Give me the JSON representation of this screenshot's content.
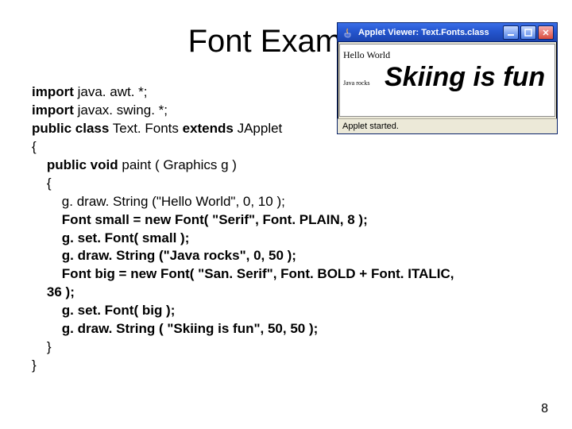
{
  "title": "Font Example",
  "code_lines": [
    {
      "indent": 0,
      "runs": [
        {
          "b": true,
          "t": "import"
        },
        {
          "b": false,
          "t": " java. awt. *;"
        }
      ]
    },
    {
      "indent": 0,
      "runs": [
        {
          "b": true,
          "t": "import"
        },
        {
          "b": false,
          "t": " javax. swing. *;"
        }
      ]
    },
    {
      "indent": 0,
      "runs": [
        {
          "b": true,
          "t": "public class"
        },
        {
          "b": false,
          "t": " Text. Fonts "
        },
        {
          "b": true,
          "t": "extends"
        },
        {
          "b": false,
          "t": " JApplet"
        }
      ]
    },
    {
      "indent": 0,
      "runs": [
        {
          "b": false,
          "t": "{"
        }
      ]
    },
    {
      "indent": 1,
      "runs": [
        {
          "b": true,
          "t": "public void"
        },
        {
          "b": false,
          "t": " paint ( Graphics g )"
        }
      ]
    },
    {
      "indent": 1,
      "runs": [
        {
          "b": false,
          "t": "{"
        }
      ]
    },
    {
      "indent": 2,
      "runs": [
        {
          "b": false,
          "t": "g. draw. String (\"Hello World\", 0, 10 );"
        }
      ]
    },
    {
      "indent": 2,
      "runs": [
        {
          "b": true,
          "t": "Font small = new Font( \"Serif\", Font. PLAIN, 8 );"
        }
      ]
    },
    {
      "indent": 2,
      "runs": [
        {
          "b": true,
          "t": "g. set. Font( small );"
        }
      ]
    },
    {
      "indent": 2,
      "runs": [
        {
          "b": true,
          "t": "g. draw. String (\"Java rocks\", 0, 50 );"
        }
      ]
    },
    {
      "indent": 2,
      "runs": [
        {
          "b": true,
          "t": "Font big = new Font( \"San. Serif\", Font. BOLD + Font. ITALIC,"
        }
      ]
    },
    {
      "indent": 1,
      "runs": [
        {
          "b": true,
          "t": "36 );"
        }
      ]
    },
    {
      "indent": 2,
      "runs": [
        {
          "b": true,
          "t": "g. set. Font( big );"
        }
      ]
    },
    {
      "indent": 2,
      "runs": [
        {
          "b": true,
          "t": "g. draw. String ( \"Skiing is fun\", 50, 50 );"
        }
      ]
    },
    {
      "indent": 1,
      "runs": [
        {
          "b": false,
          "t": "}"
        }
      ]
    },
    {
      "indent": 0,
      "runs": [
        {
          "b": false,
          "t": "}"
        }
      ]
    }
  ],
  "page_number": "8",
  "applet": {
    "title": "Applet Viewer: Text.Fonts.class",
    "hello": "Hello World",
    "java_rocks": "Java rocks",
    "skiing": "Skiing is fun",
    "status": "Applet started."
  }
}
